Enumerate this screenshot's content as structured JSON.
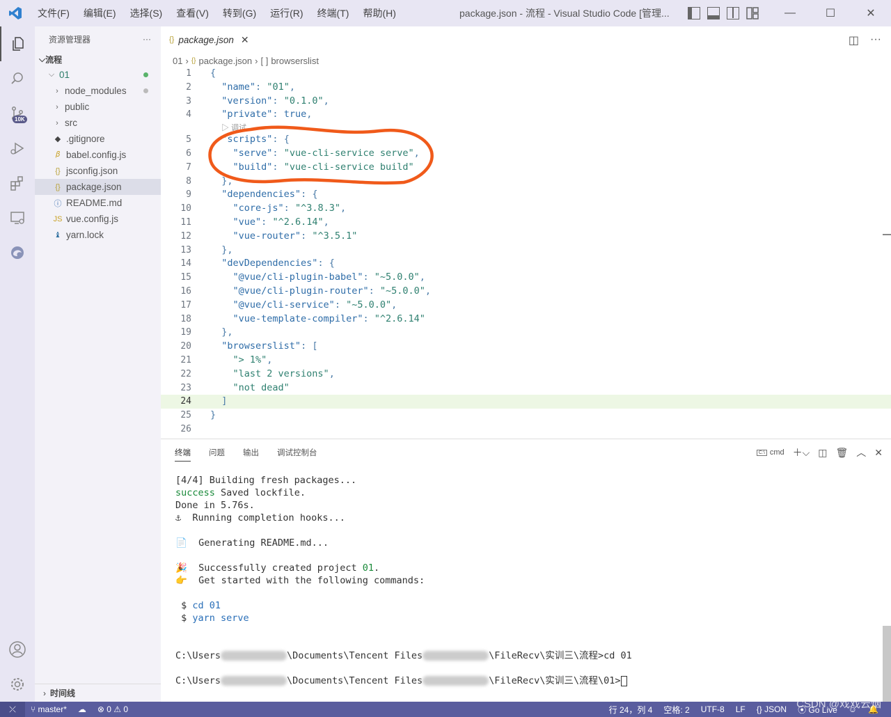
{
  "titlebar": {
    "menu": [
      "文件(F)",
      "编辑(E)",
      "选择(S)",
      "查看(V)",
      "转到(G)",
      "运行(R)",
      "终端(T)",
      "帮助(H)"
    ],
    "title": "package.json - 流程 - Visual Studio Code [管理..."
  },
  "activity": {
    "badge": "10K"
  },
  "sidebar": {
    "header": "资源管理器",
    "more": "···",
    "section": "流程",
    "items": [
      {
        "label": "01",
        "icon": "folder-open",
        "level": 0
      },
      {
        "label": "node_modules",
        "icon": "folder",
        "level": 1
      },
      {
        "label": "public",
        "icon": "folder",
        "level": 1
      },
      {
        "label": "src",
        "icon": "folder",
        "level": 1
      },
      {
        "label": ".gitignore",
        "icon": "git",
        "level": 1
      },
      {
        "label": "babel.config.js",
        "icon": "babel",
        "level": 1
      },
      {
        "label": "jsconfig.json",
        "icon": "json",
        "level": 1
      },
      {
        "label": "package.json",
        "icon": "json",
        "level": 1
      },
      {
        "label": "README.md",
        "icon": "info",
        "level": 1
      },
      {
        "label": "vue.config.js",
        "icon": "js",
        "level": 1
      },
      {
        "label": "yarn.lock",
        "icon": "yarn",
        "level": 1
      }
    ],
    "timeline": "时间线"
  },
  "editor": {
    "tab": "package.json",
    "breadcrumb": [
      "01",
      "package.json",
      "browserslist"
    ],
    "codelens": "▷ 调试",
    "lines": [
      {
        "n": "1",
        "t": "{"
      },
      {
        "n": "2",
        "t": "  \"name\": \"01\","
      },
      {
        "n": "3",
        "t": "  \"version\": \"0.1.0\","
      },
      {
        "n": "4",
        "t": "  \"private\": true,"
      },
      {
        "n": "5",
        "t": "  \"scripts\": {"
      },
      {
        "n": "6",
        "t": "    \"serve\": \"vue-cli-service serve\","
      },
      {
        "n": "7",
        "t": "    \"build\": \"vue-cli-service build\""
      },
      {
        "n": "8",
        "t": "  },"
      },
      {
        "n": "9",
        "t": "  \"dependencies\": {"
      },
      {
        "n": "10",
        "t": "    \"core-js\": \"^3.8.3\","
      },
      {
        "n": "11",
        "t": "    \"vue\": \"^2.6.14\","
      },
      {
        "n": "12",
        "t": "    \"vue-router\": \"^3.5.1\""
      },
      {
        "n": "13",
        "t": "  },"
      },
      {
        "n": "14",
        "t": "  \"devDependencies\": {"
      },
      {
        "n": "15",
        "t": "    \"@vue/cli-plugin-babel\": \"~5.0.0\","
      },
      {
        "n": "16",
        "t": "    \"@vue/cli-plugin-router\": \"~5.0.0\","
      },
      {
        "n": "17",
        "t": "    \"@vue/cli-service\": \"~5.0.0\","
      },
      {
        "n": "18",
        "t": "    \"vue-template-compiler\": \"^2.6.14\""
      },
      {
        "n": "19",
        "t": "  },"
      },
      {
        "n": "20",
        "t": "  \"browserslist\": ["
      },
      {
        "n": "21",
        "t": "    \"> 1%\","
      },
      {
        "n": "22",
        "t": "    \"last 2 versions\","
      },
      {
        "n": "23",
        "t": "    \"not dead\""
      },
      {
        "n": "24",
        "t": "  ]"
      },
      {
        "n": "25",
        "t": "}"
      },
      {
        "n": "26",
        "t": ""
      }
    ],
    "active_line": "24"
  },
  "panel": {
    "tabs": [
      "终端",
      "问题",
      "输出",
      "调试控制台"
    ],
    "terminal_name": "cmd",
    "terminal": {
      "l1": "[4/4] Building fresh packages...",
      "l2a": "success",
      "l2b": " Saved lockfile.",
      "l3": "Done in 5.76s.",
      "l4": "Running completion hooks...",
      "l5": "Generating README.md...",
      "l6a": "Successfully created project ",
      "l6b": "01",
      "l6c": ".",
      "l7": "Get started with the following commands:",
      "l8a": " $ ",
      "l8b": "cd 01",
      "l9a": " $ ",
      "l9b": "yarn serve",
      "p1a": "C:\\Users",
      "p1b": "\\Documents\\Tencent Files",
      "p1c": "\\FileRecv\\实训三\\流程>cd 01",
      "p2a": "C:\\Users",
      "p2b": "\\Documents\\Tencent Files",
      "p2c": "\\FileRecv\\实训三\\流程\\01>"
    }
  },
  "statusbar": {
    "branch": "master*",
    "problems": "⊗ 0 ⚠ 0",
    "position": "行 24，列 4",
    "spaces": "空格: 2",
    "encoding": "UTF-8",
    "eol": "LF",
    "language": "{} JSON",
    "golive": "Go Live",
    "watermark": "CSDN @戏戏云烟",
    "accent": "#5a5d9e"
  }
}
